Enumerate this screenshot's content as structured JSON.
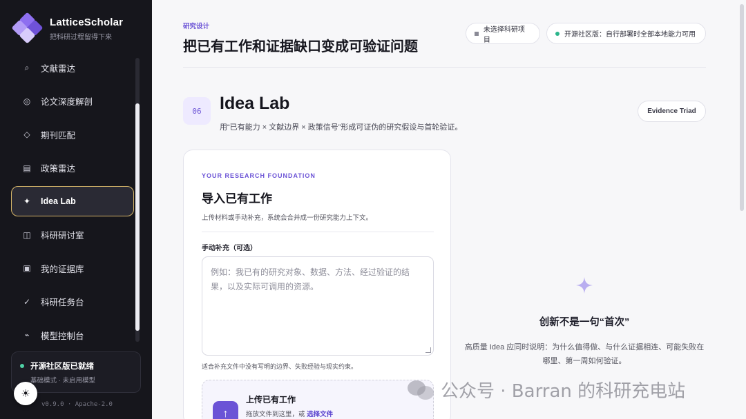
{
  "app": {
    "name": "LatticeScholar",
    "tagline": "把科研过程留得下来",
    "version": "v0.9.0 · Apache-2.0"
  },
  "sidebar": {
    "items": [
      {
        "label": "文献雷达",
        "icon": "radar-icon"
      },
      {
        "label": "论文深度解剖",
        "icon": "target-icon"
      },
      {
        "label": "期刊匹配",
        "icon": "diamond-icon"
      },
      {
        "label": "政策雷达",
        "icon": "list-icon"
      },
      {
        "label": "Idea Lab",
        "icon": "sparkle-icon",
        "active": true
      },
      {
        "label": "科研研讨室",
        "icon": "columns-icon"
      },
      {
        "label": "我的证据库",
        "icon": "box-icon"
      },
      {
        "label": "科研任务台",
        "icon": "check-icon"
      },
      {
        "label": "模型控制台",
        "icon": "wave-icon"
      }
    ],
    "status": {
      "title": "开源社区版已就绪",
      "sub": "基础模式 · 未启用模型"
    }
  },
  "header": {
    "eyebrow": "研究设计",
    "title": "把已有工作和证据缺口变成可验证问题",
    "project_pill": "未选择科研项目",
    "edition_pill": "开源社区版：自行部署时全部本地能力可用"
  },
  "section": {
    "number": "06",
    "title": "Idea Lab",
    "subtitle": "用“已有能力 × 文献边界 × 政策信号”形成可证伪的研究假设与首轮验证。",
    "triad_button": "Evidence Triad"
  },
  "foundation_card": {
    "eyebrow": "YOUR RESEARCH FOUNDATION",
    "title": "导入已有工作",
    "description": "上传材料或手动补充，系统会合并成一份研究能力上下文。",
    "manual_label": "手动补充（可选）",
    "manual_placeholder": "例如：我已有的研究对象、数据、方法、经过验证的结果，以及实际可调用的资源。",
    "helper": "适合补充文件中没有写明的边界、失败经验与现实约束。",
    "upload_title": "上传已有工作",
    "upload_sub": "拖放文件到这里，或",
    "upload_link": "选择文件"
  },
  "empty_state": {
    "title": "创新不是一句“首次”",
    "description": "高质量 Idea 应同时说明：为什么值得做、与什么证据相连、可能失败在哪里、第一周如何验证。"
  },
  "watermark": {
    "text": "公众号 · Barran 的科研充电站"
  },
  "colors": {
    "accent": "#6b53d6",
    "sidebar_bg": "#16161c",
    "active_border": "#d9b86a",
    "status_green": "#4fd1a5"
  }
}
